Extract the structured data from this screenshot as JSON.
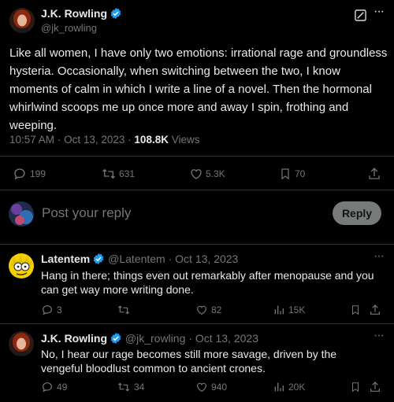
{
  "main_tweet": {
    "author_name": "J.K. Rowling",
    "author_handle": "@jk_rowling",
    "text": "Like all women, I have only two emotions: irrational rage and groundless hysteria. Occasionally, when switching between the two, I know moments of calm in which I write a line of a novel. Then the hormonal whirlwind scoops me up once more and away I spin, frothing and weeping.",
    "time": "10:57 AM",
    "date": "Oct 13, 2023",
    "views_count": "108.8K",
    "views_label": "Views",
    "replies": "199",
    "reposts": "631",
    "likes": "5.3K",
    "bookmarks": "70"
  },
  "reply_box": {
    "placeholder": "Post your reply",
    "button_label": "Reply"
  },
  "replies": [
    {
      "author_name": "Latentem",
      "author_handle": "@Latentem",
      "date": "Oct 13, 2023",
      "separator": "·",
      "text": "Hang in there; things even out remarkably after menopause and you can get way more writing done.",
      "replies": "3",
      "reposts": "",
      "likes": "82",
      "views": "15K"
    },
    {
      "author_name": "J.K. Rowling",
      "author_handle": "@jk_rowling",
      "date": "Oct 13, 2023",
      "separator": "·",
      "text": "No, I hear our rage becomes still more savage, driven by the vengeful bloodlust common to ancient crones.",
      "replies": "49",
      "reposts": "34",
      "likes": "940",
      "views": "20K"
    }
  ],
  "more_icon_text": "···",
  "dot_separator": "·",
  "colors": {
    "background": "#000000",
    "text": "#e7e9ea",
    "muted": "#71767b",
    "verified": "#1d9bf0",
    "divider": "#2f3336",
    "reply_button": "#787a7a"
  }
}
